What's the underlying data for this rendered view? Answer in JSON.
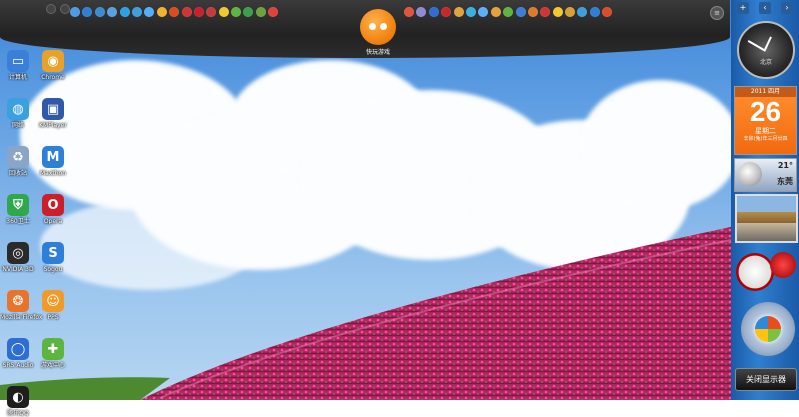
{
  "toolbar": {
    "logo_label": "快玩游戏",
    "left_icons": [
      {
        "name": "window-icon",
        "color": "#4a9be8"
      },
      {
        "name": "ie-icon",
        "color": "#2e7fd8"
      },
      {
        "name": "apps-icon",
        "color": "#3a8bd6"
      },
      {
        "name": "monitor-icon",
        "color": "#5aa0e0"
      },
      {
        "name": "qq-music-icon",
        "color": "#2aa3e6"
      },
      {
        "name": "ppstream-icon",
        "color": "#3c9fe2"
      },
      {
        "name": "bubble-icon",
        "color": "#4fb0ff"
      },
      {
        "name": "chrome-icon",
        "color": "#f1b32a"
      },
      {
        "name": "media-icon",
        "color": "#d94c1e"
      },
      {
        "name": "video-icon",
        "color": "#d23434"
      },
      {
        "name": "opera-icon",
        "color": "#cc1f2a"
      },
      {
        "name": "mushroom-icon",
        "color": "#c63a3a"
      },
      {
        "name": "star-icon",
        "color": "#f2c82c"
      },
      {
        "name": "leaf-icon",
        "color": "#5cb53e"
      },
      {
        "name": "image-icon",
        "color": "#3ba04a"
      },
      {
        "name": "window-icon-2",
        "color": "#6aa43a"
      },
      {
        "name": "mail-icon",
        "color": "#e0413a"
      }
    ],
    "right_icons": [
      {
        "name": "thunder-icon",
        "color": "#e0553a"
      },
      {
        "name": "box-icon",
        "color": "#8e8ad6"
      },
      {
        "name": "qvod-icon",
        "color": "#2e6ed2"
      },
      {
        "name": "red-circle-icon",
        "color": "#c8262b"
      },
      {
        "name": "game-icon",
        "color": "#e0a43a"
      },
      {
        "name": "play-icon",
        "color": "#3ab0e0"
      },
      {
        "name": "music-icon",
        "color": "#5ab0ff"
      },
      {
        "name": "rocket-icon",
        "color": "#e8a23a"
      },
      {
        "name": "shield-icon",
        "color": "#5cb53e"
      },
      {
        "name": "bird-icon",
        "color": "#3a7fd8"
      },
      {
        "name": "fish-icon",
        "color": "#e07a2a"
      },
      {
        "name": "mushroom-icon-2",
        "color": "#d23434"
      },
      {
        "name": "smile-icon",
        "color": "#f2c82c"
      },
      {
        "name": "flower-icon",
        "color": "#d8a030"
      },
      {
        "name": "compass-icon",
        "color": "#3aa0e0"
      },
      {
        "name": "blue-icon",
        "color": "#2e7fd8"
      },
      {
        "name": "tiger-icon",
        "color": "#e04a2a"
      }
    ]
  },
  "desktop_icons": [
    {
      "name": "computer",
      "label": "计算机",
      "glyph": "▭",
      "color": "#3a7fd8"
    },
    {
      "name": "chrome",
      "label": "Chrome",
      "glyph": "◉",
      "color": "#e8a22a"
    },
    {
      "name": "network",
      "label": "网络",
      "glyph": "◍",
      "color": "#3aa0e0"
    },
    {
      "name": "kmplayer",
      "label": "KMPlayer",
      "glyph": "▣",
      "color": "#2e5aa8"
    },
    {
      "name": "recycle-bin",
      "label": "回收站",
      "glyph": "♻",
      "color": "#8aa6c6"
    },
    {
      "name": "maxthon",
      "label": "Maxthon",
      "glyph": "M",
      "color": "#2e7fd8"
    },
    {
      "name": "security-guard",
      "label": "360卫士",
      "glyph": "⛨",
      "color": "#2ea84a"
    },
    {
      "name": "opera",
      "label": "Opera",
      "glyph": "O",
      "color": "#cc1f2a"
    },
    {
      "name": "nvidia",
      "label": "NVIDIA 3D",
      "glyph": "◎",
      "color": "#2a2a2a"
    },
    {
      "name": "sogou",
      "label": "Sogou",
      "glyph": "S",
      "color": "#2e7fd8"
    },
    {
      "name": "firefox",
      "label": "Mozilla Firefox",
      "glyph": "❂",
      "color": "#e8732a"
    },
    {
      "name": "pps",
      "label": "PPS",
      "glyph": "☺",
      "color": "#f09a2a"
    },
    {
      "name": "srs-audio",
      "label": "SRS Audio",
      "glyph": "◯",
      "color": "#2e6ed2"
    },
    {
      "name": "game-center",
      "label": "游戏中心",
      "glyph": "✚",
      "color": "#5cb53e"
    },
    {
      "name": "qq",
      "label": "腾讯QQ",
      "glyph": "◐",
      "color": "#1e1e1e"
    }
  ],
  "sidebar": {
    "clock_city": "北京",
    "calendar": {
      "header": "2011 四月",
      "day": "26",
      "weekday": "星期二",
      "lunar": "辛卯(兔)年三月廿四"
    },
    "weather": {
      "temp": "21°",
      "city": "东莞"
    },
    "close_display_label": "关闭显示器"
  },
  "colors": {
    "sidebar": "#1a5aa8",
    "toolbar": "#2a2a2a",
    "calendar": "#f07a1a"
  }
}
